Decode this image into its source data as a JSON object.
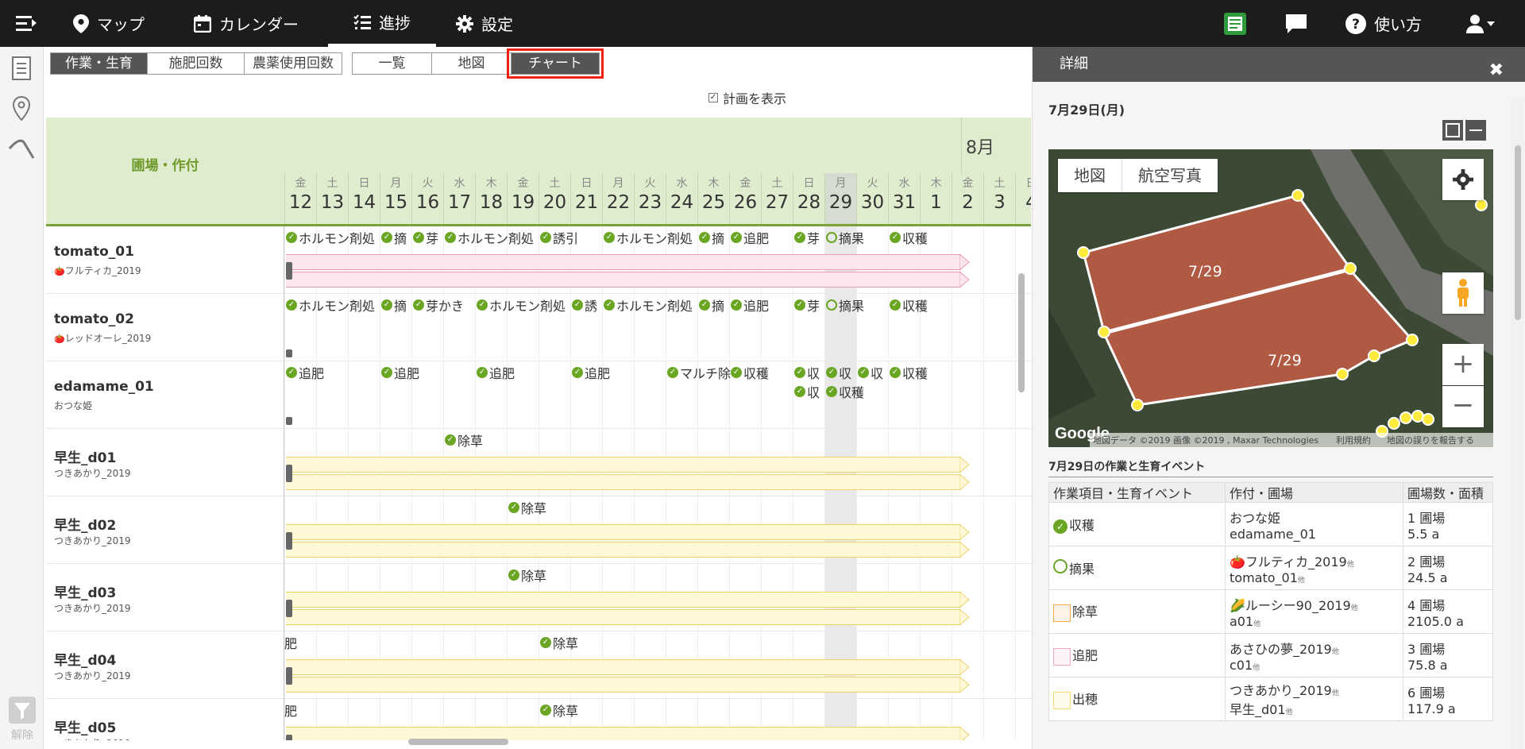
{
  "nav": {
    "map": "マップ",
    "calendar": "カレンダー",
    "progress": "進捗",
    "settings": "設定",
    "help": "使い方"
  },
  "toolbar": {
    "view1": [
      "作業・生育",
      "施肥回数",
      "農薬使用回数"
    ],
    "view2": [
      "一覧",
      "地図",
      "チャート"
    ],
    "plan": "計画を表示"
  },
  "sidebar": {
    "filter_clear": "解除"
  },
  "grid": {
    "header": "圃場・作付",
    "month": "8月",
    "dates": [
      {
        "w": "金",
        "n": "12"
      },
      {
        "w": "土",
        "n": "13"
      },
      {
        "w": "日",
        "n": "14"
      },
      {
        "w": "月",
        "n": "15"
      },
      {
        "w": "火",
        "n": "16"
      },
      {
        "w": "水",
        "n": "17"
      },
      {
        "w": "木",
        "n": "18"
      },
      {
        "w": "金",
        "n": "19"
      },
      {
        "w": "土",
        "n": "20"
      },
      {
        "w": "日",
        "n": "21"
      },
      {
        "w": "月",
        "n": "22"
      },
      {
        "w": "火",
        "n": "23"
      },
      {
        "w": "水",
        "n": "24"
      },
      {
        "w": "木",
        "n": "25"
      },
      {
        "w": "金",
        "n": "26"
      },
      {
        "w": "土",
        "n": "27"
      },
      {
        "w": "日",
        "n": "28"
      },
      {
        "w": "月",
        "n": "29"
      },
      {
        "w": "火",
        "n": "30"
      },
      {
        "w": "水",
        "n": "31"
      },
      {
        "w": "木",
        "n": "1"
      },
      {
        "w": "金",
        "n": "2"
      },
      {
        "w": "土",
        "n": "3"
      },
      {
        "w": "日",
        "n": "4"
      }
    ],
    "rows": [
      {
        "name": "tomato_01",
        "crop": "フルティカ_2019",
        "bar": "pink",
        "events": [
          {
            "d": 0,
            "t": "ホルモン剤処"
          },
          {
            "d": 3,
            "t": "摘"
          },
          {
            "d": 4,
            "t": "芽"
          },
          {
            "d": 5,
            "t": "ホルモン剤処"
          },
          {
            "d": 8,
            "t": "誘引"
          },
          {
            "d": 10,
            "t": "ホルモン剤処"
          },
          {
            "d": 13,
            "t": "摘"
          },
          {
            "d": 14,
            "t": "追肥"
          },
          {
            "d": 16,
            "t": "芽"
          },
          {
            "d": 17,
            "t": "摘果",
            "ring": true
          },
          {
            "d": 19,
            "t": "収穫"
          }
        ]
      },
      {
        "name": "tomato_02",
        "crop": "レッドオーレ_2019",
        "bar": "",
        "events": [
          {
            "d": 0,
            "t": "ホルモン剤処"
          },
          {
            "d": 3,
            "t": "摘"
          },
          {
            "d": 4,
            "t": "芽かき"
          },
          {
            "d": 6,
            "t": "ホルモン剤処"
          },
          {
            "d": 9,
            "t": "誘"
          },
          {
            "d": 10,
            "t": "ホルモン剤処"
          },
          {
            "d": 13,
            "t": "摘"
          },
          {
            "d": 14,
            "t": "追肥"
          },
          {
            "d": 16,
            "t": "芽"
          },
          {
            "d": 17,
            "t": "摘果",
            "ring": true
          },
          {
            "d": 19,
            "t": "収穫"
          }
        ]
      },
      {
        "name": "edamame_01",
        "crop": "おつな姫",
        "bar": "",
        "events": [
          {
            "d": 0,
            "t": "追肥"
          },
          {
            "d": 3,
            "t": "追肥"
          },
          {
            "d": 6,
            "t": "追肥"
          },
          {
            "d": 9,
            "t": "追肥"
          },
          {
            "d": 12,
            "t": "マルチ除"
          },
          {
            "d": 14,
            "t": "収穫"
          },
          {
            "d": 16,
            "t": "収"
          },
          {
            "d": 17,
            "t": "収"
          },
          {
            "d": 18,
            "t": "収"
          },
          {
            "d": 19,
            "t": "収穫"
          },
          {
            "d": 16,
            "t": "収",
            "l2": true
          },
          {
            "d": 17,
            "t": "収穫",
            "l2": true
          }
        ]
      },
      {
        "name": "早生_d01",
        "crop": "つきあかり_2019",
        "bar": "yellow",
        "events": [
          {
            "d": 5,
            "t": "除草"
          }
        ]
      },
      {
        "name": "早生_d02",
        "crop": "つきあかり_2019",
        "bar": "yellow",
        "events": [
          {
            "d": 7,
            "t": "除草"
          }
        ]
      },
      {
        "name": "早生_d03",
        "crop": "つきあかり_2019",
        "bar": "yellow",
        "events": [
          {
            "d": 7,
            "t": "除草"
          }
        ]
      },
      {
        "name": "早生_d04",
        "crop": "つきあかり_2019",
        "bar": "yellow",
        "events": [
          {
            "d": -1,
            "t": "肥"
          },
          {
            "d": 8,
            "t": "除草"
          }
        ]
      },
      {
        "name": "早生_d05",
        "crop": "つきあかり_2019",
        "bar": "yellow",
        "events": [
          {
            "d": -1,
            "t": "肥"
          },
          {
            "d": 8,
            "t": "除草"
          }
        ]
      }
    ]
  },
  "panel": {
    "title": "詳細",
    "date": "7月29日(月)",
    "map": {
      "tab_map": "地図",
      "tab_aerial": "航空写真",
      "label": "7/29",
      "road": "道路",
      "credit": "地図データ ©2019 画像 ©2019 , Maxar Technologies",
      "terms": "利用規約",
      "report": "地図の誤りを報告する",
      "google": "Google"
    },
    "events_title": "7月29日の作業と生育イベント",
    "headers": [
      "作業項目・生育イベント",
      "作付・圃場",
      "圃場数・面積"
    ],
    "rows": [
      {
        "item": "収穫",
        "crop": "おつな姫",
        "field": "edamame_01",
        "count": "1 圃場",
        "area": "5.5 a",
        "sym": "check"
      },
      {
        "item": "摘果",
        "crop": "フルティカ_2019",
        "field": "tomato_01",
        "count": "2 圃場",
        "area": "24.5 a",
        "sym": "ring",
        "icon": "🍅",
        "other": "他"
      },
      {
        "item": "除草",
        "crop": "ルーシー90_2019",
        "field": "a01",
        "count": "4 圃場",
        "area": "2105.0 a",
        "sym": "#f5a64a",
        "icon": "🌽",
        "other": "他"
      },
      {
        "item": "追肥",
        "crop": "あさひの夢_2019",
        "field": "c01",
        "count": "3 圃場",
        "area": "75.8 a",
        "sym": "#f1a8b8",
        "other": "他"
      },
      {
        "item": "出穂",
        "crop": "つきあかり_2019",
        "field": "早生_d01",
        "count": "6 圃場",
        "area": "117.9 a",
        "sym": "#f5dc72",
        "other": "他"
      }
    ]
  }
}
